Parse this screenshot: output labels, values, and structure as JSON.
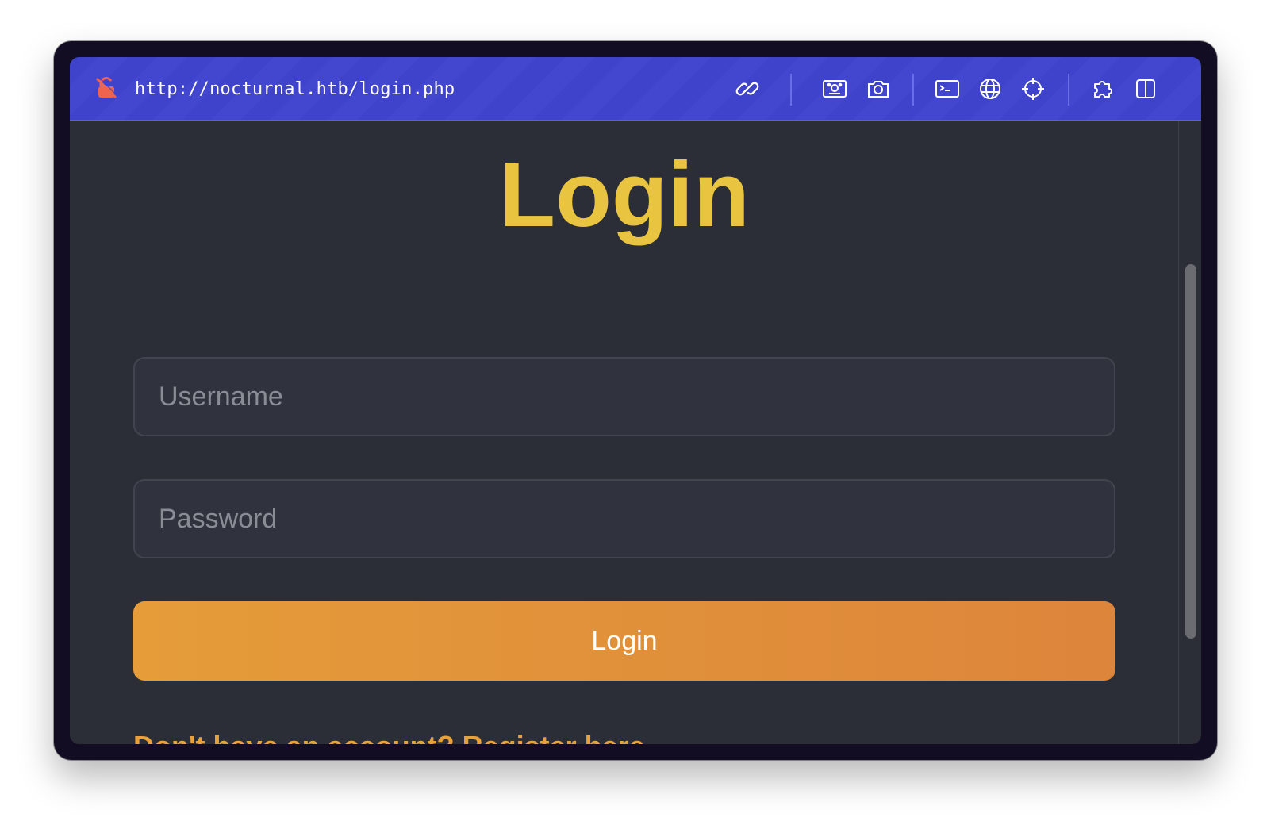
{
  "browser": {
    "url": "http://nocturnal.htb/login.php",
    "toolbar_icons": [
      "lock-off-icon",
      "link-icon",
      "image-icon",
      "camera-icon",
      "terminal-icon",
      "globe-icon",
      "crosshair-icon",
      "puzzle-icon",
      "sidebar-icon"
    ],
    "accent_color": "#4044cc"
  },
  "page": {
    "title": "Login",
    "username_placeholder": "Username",
    "password_placeholder": "Password",
    "login_button": "Login",
    "register_link": "Don't have an account? Register here",
    "colors": {
      "background": "#2b2e37",
      "title": "#e9c440",
      "button": "#e29339",
      "link": "#e9a23b"
    }
  }
}
